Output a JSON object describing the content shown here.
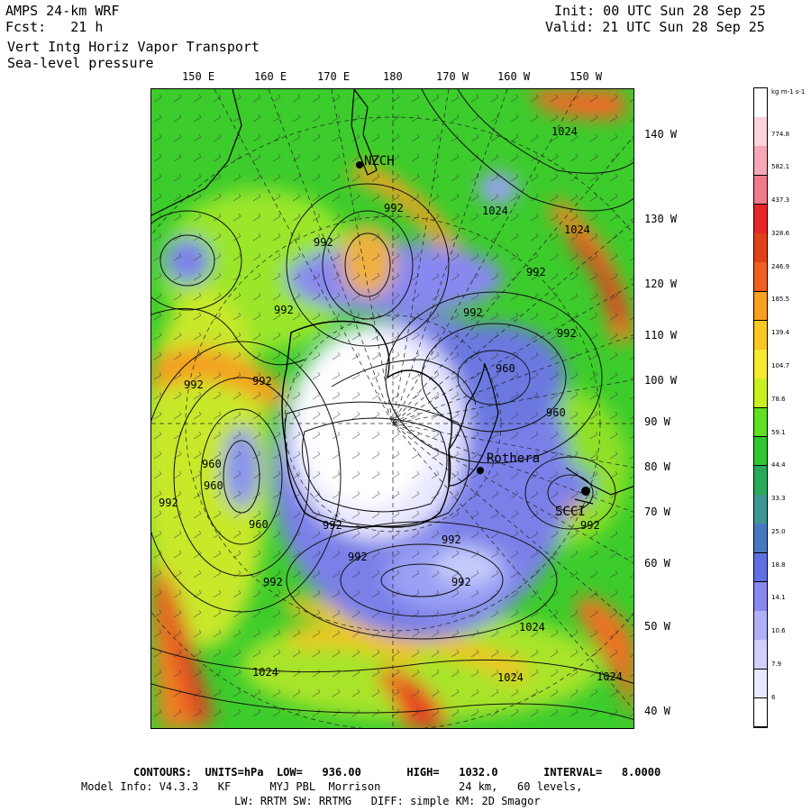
{
  "header": {
    "model": "AMPS 24-km WRF",
    "forecast": "Fcst:   21 h",
    "field1": "Vert Intg Horiz Vapor Transport",
    "field2": "Sea-level pressure",
    "init": "Init: 00 UTC Sun 28 Sep 25",
    "valid": "Valid: 21 UTC Sun 28 Sep 25"
  },
  "lon_labels": [
    "150 E",
    "160 E",
    "170 E",
    "180",
    "170 W",
    "160 W",
    "150 W"
  ],
  "lat_labels": [
    "140 W",
    "130 W",
    "120 W",
    "110 W",
    "100 W",
    "90 W",
    "80 W",
    "70 W",
    "60 W",
    "50 W",
    "40 W"
  ],
  "map": {
    "station_labels": [
      "NZCH",
      "Rothera",
      "SCCI"
    ],
    "contour_labels": [
      "1024",
      "1024",
      "1024",
      "992",
      "992",
      "992",
      "992",
      "992",
      "992",
      "992",
      "992",
      "992",
      "992",
      "992",
      "992",
      "960",
      "960",
      "960",
      "960",
      "960",
      "992",
      "1024",
      "1024",
      "1024",
      "1024",
      "992",
      "992"
    ]
  },
  "colorbar": {
    "units": "kg m-1 s-1",
    "labels": [
      "774.8",
      "582.1",
      "437.3",
      "328.6",
      "246.9",
      "185.5",
      "139.4",
      "104.7",
      "78.6",
      "59.1",
      "44.4",
      "33.3",
      "25.0",
      "18.8",
      "14.1",
      "10.6",
      "7.9",
      "6"
    ],
    "colors": [
      "#ffffff",
      "#fbd3dc",
      "#f7a8b8",
      "#f07a8a",
      "#e8262a",
      "#e0401a",
      "#f06020",
      "#f8a020",
      "#f8c820",
      "#f8e830",
      "#c8f020",
      "#60e020",
      "#30c830",
      "#28a858",
      "#3c9890",
      "#4878c0",
      "#6070e0",
      "#8888f0",
      "#b0b0f8",
      "#d0d0fc",
      "#e8e8ff",
      "#ffffff"
    ]
  },
  "footer": {
    "contours": "CONTOURS:  UNITS=hPa  LOW=   936.00       HIGH=   1032.0       INTERVAL=   8.0000",
    "model_info": "Model Info: V4.3.3   KF      MYJ PBL  Morrison            24 km,   60 levels,",
    "physics": "LW: RRTM SW: RRTMG   DIFF: simple KM: 2D Smagor"
  }
}
